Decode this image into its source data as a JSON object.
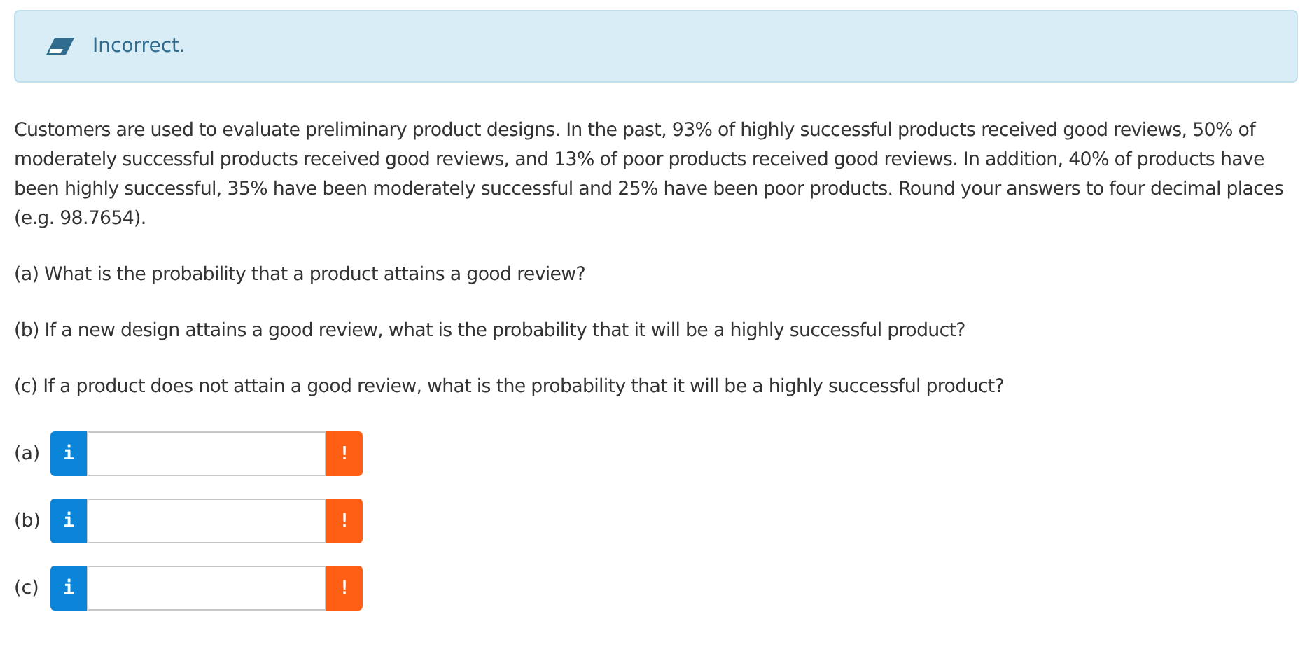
{
  "alert": {
    "kind": "error",
    "message": "Incorrect."
  },
  "problem": "Customers are used to evaluate preliminary product designs. In the past, 93% of highly successful products received good reviews, 50% of moderately successful products received good reviews, and 13% of poor products received good reviews. In addition, 40% of products have been highly successful, 35% have been moderately successful and 25% have been poor products. Round your answers to four decimal places (e.g. 98.7654).",
  "questions": [
    "(a) What is the probability that a product attains a good review?",
    "(b) If a new design attains a good review, what is the probability that it will be a highly successful product?",
    "(c) If a product does not attain a good review, what is the probability that it will be a highly successful product?"
  ],
  "answers": [
    {
      "label": "(a)",
      "info": "i",
      "flag": "!"
    },
    {
      "label": "(b)",
      "info": "i",
      "flag": "!"
    },
    {
      "label": "(c)",
      "info": "i",
      "flag": "!"
    }
  ]
}
